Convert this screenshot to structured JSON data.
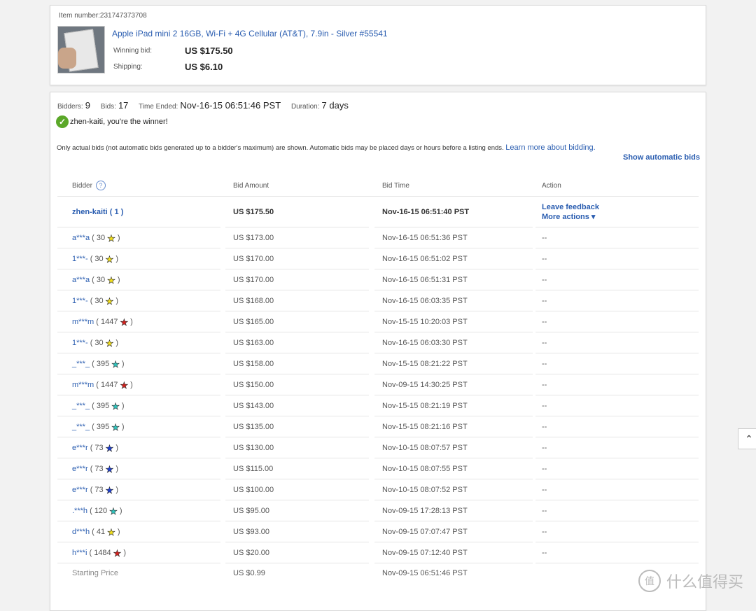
{
  "item": {
    "number_label": "Item number:",
    "number": "231747373708",
    "title": "Apple iPad mini 2 16GB, Wi-Fi + 4G Cellular (AT&T), 7.9in - Silver #55541",
    "winning_bid_label": "Winning bid:",
    "winning_bid": "US $175.50",
    "shipping_label": "Shipping:",
    "shipping": "US $6.10"
  },
  "summary": {
    "bidders_label": "Bidders:",
    "bidders": "9",
    "bids_label": "Bids:",
    "bids": "17",
    "time_ended_label": "Time Ended:",
    "time_ended": "Nov-16-15 06:51:46 PST",
    "duration_label": "Duration:",
    "duration": "7 days",
    "winner_text": "zhen-kaiti, you're the winner!"
  },
  "notice": {
    "text": "Only actual bids (not automatic bids generated up to a bidder's maximum) are shown. Automatic bids may be placed days or hours before a listing ends.",
    "link": "Learn more about bidding.",
    "show_automatic": "Show automatic bids"
  },
  "table": {
    "headers": [
      "Bidder",
      "Bid Amount",
      "Bid Time",
      "Action"
    ],
    "winner": {
      "bidder": "zhen-kaiti",
      "score": "( 1 )",
      "amount": "US $175.50",
      "time": "Nov-16-15 06:51:40 PST",
      "action1": "Leave feedback",
      "action2": "More actions"
    },
    "rows": [
      {
        "bidder": "a***a",
        "score": "( 30",
        "star": "#f5e21c",
        "amount": "US $173.00",
        "time": "Nov-16-15 06:51:36 PST",
        "action": "--"
      },
      {
        "bidder": "1***-",
        "score": "( 30",
        "star": "#f5e21c",
        "amount": "US $170.00",
        "time": "Nov-16-15 06:51:02 PST",
        "action": "--"
      },
      {
        "bidder": "a***a",
        "score": "( 30",
        "star": "#f5e21c",
        "amount": "US $170.00",
        "time": "Nov-16-15 06:51:31 PST",
        "action": "--"
      },
      {
        "bidder": "1***-",
        "score": "( 30",
        "star": "#f5e21c",
        "amount": "US $168.00",
        "time": "Nov-16-15 06:03:35 PST",
        "action": "--"
      },
      {
        "bidder": "m***m",
        "score": "( 1447",
        "star": "#d9201c",
        "amount": "US $165.00",
        "time": "Nov-15-15 10:20:03 PST",
        "action": "--"
      },
      {
        "bidder": "1***-",
        "score": "( 30",
        "star": "#f5e21c",
        "amount": "US $163.00",
        "time": "Nov-16-15 06:03:30 PST",
        "action": "--"
      },
      {
        "bidder": "_***_",
        "score": "( 395",
        "star": "#2fc9c2",
        "amount": "US $158.00",
        "time": "Nov-15-15 08:21:22 PST",
        "action": "--"
      },
      {
        "bidder": "m***m",
        "score": "( 1447",
        "star": "#d9201c",
        "amount": "US $150.00",
        "time": "Nov-09-15 14:30:25 PST",
        "action": "--"
      },
      {
        "bidder": "_***_",
        "score": "( 395",
        "star": "#2fc9c2",
        "amount": "US $143.00",
        "time": "Nov-15-15 08:21:19 PST",
        "action": "--"
      },
      {
        "bidder": "_***_",
        "score": "( 395",
        "star": "#2fc9c2",
        "amount": "US $135.00",
        "time": "Nov-15-15 08:21:16 PST",
        "action": "--"
      },
      {
        "bidder": "e***r",
        "score": "( 73",
        "star": "#1c3fd9",
        "amount": "US $130.00",
        "time": "Nov-10-15 08:07:57 PST",
        "action": "--"
      },
      {
        "bidder": "e***r",
        "score": "( 73",
        "star": "#1c3fd9",
        "amount": "US $115.00",
        "time": "Nov-10-15 08:07:55 PST",
        "action": "--"
      },
      {
        "bidder": "e***r",
        "score": "( 73",
        "star": "#1c3fd9",
        "amount": "US $100.00",
        "time": "Nov-10-15 08:07:52 PST",
        "action": "--"
      },
      {
        "bidder": ".***h",
        "score": "( 120",
        "star": "#2fc9c2",
        "amount": "US $95.00",
        "time": "Nov-09-15 17:28:13 PST",
        "action": "--"
      },
      {
        "bidder": "d***h",
        "score": "( 41",
        "star": "#f5e21c",
        "amount": "US $93.00",
        "time": "Nov-09-15 07:07:47 PST",
        "action": "--"
      },
      {
        "bidder": "h***i",
        "score": "( 1484",
        "star": "#d9201c",
        "amount": "US $20.00",
        "time": "Nov-09-15 07:12:40 PST",
        "action": "--"
      }
    ],
    "starting": {
      "label": "Starting Price",
      "amount": "US $0.99",
      "time": "Nov-09-15 06:51:46 PST"
    }
  },
  "watermark": {
    "text": "什么值得买",
    "icon": "值"
  }
}
